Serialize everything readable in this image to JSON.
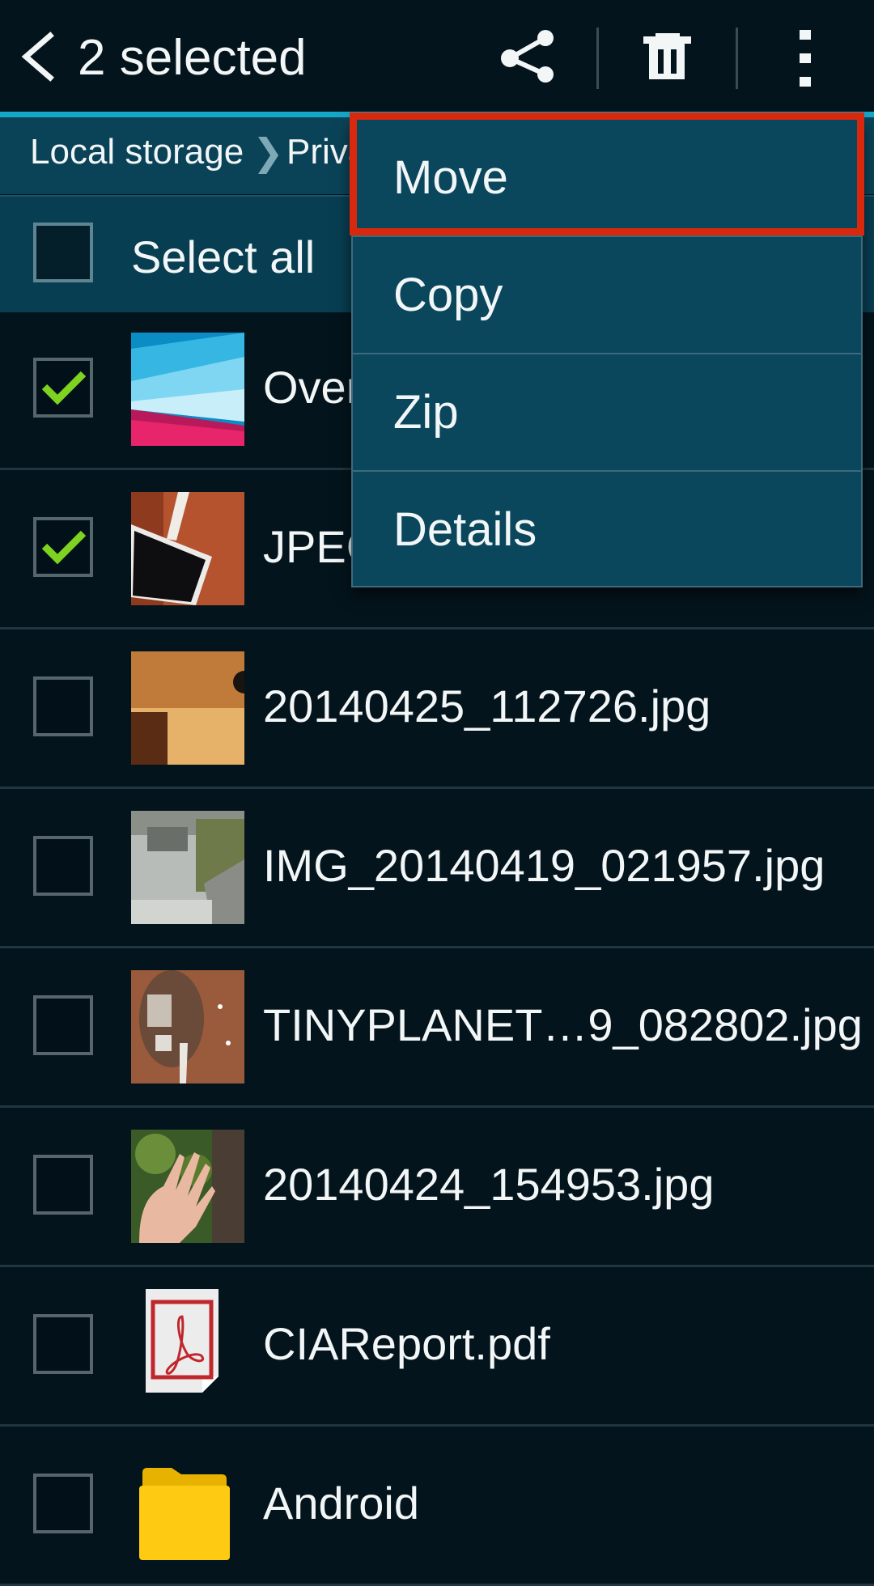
{
  "header": {
    "title": "2 selected",
    "back_icon": "chevron-left-icon",
    "actions": [
      {
        "name": "share",
        "icon": "share-icon"
      },
      {
        "name": "delete",
        "icon": "trash-icon"
      },
      {
        "name": "more",
        "icon": "more-vertical-icon"
      }
    ]
  },
  "breadcrumb": {
    "items": [
      "Local storage",
      "Priva"
    ],
    "separator": "❯"
  },
  "select_all": {
    "label": "Select all",
    "checked": false
  },
  "files": [
    {
      "name": "Over",
      "checked": true,
      "type": "image",
      "thumb": "abstract-wallpaper"
    },
    {
      "name": "JPEG",
      "checked": true,
      "type": "image",
      "thumb": "phone-on-table"
    },
    {
      "name": "20140425_112726.jpg",
      "checked": false,
      "type": "image",
      "thumb": "lamp-wall"
    },
    {
      "name": "IMG_20140419_021957.jpg",
      "checked": false,
      "type": "image",
      "thumb": "stone-steps"
    },
    {
      "name": "TINYPLANET…9_082802.jpg",
      "checked": false,
      "type": "image",
      "thumb": "tiny-planet"
    },
    {
      "name": "20140424_154953.jpg",
      "checked": false,
      "type": "image",
      "thumb": "hand-plants"
    },
    {
      "name": "CIAReport.pdf",
      "checked": false,
      "type": "pdf",
      "thumb": "pdf-icon"
    },
    {
      "name": "Android",
      "checked": false,
      "type": "folder",
      "thumb": "folder-icon"
    }
  ],
  "context_menu": {
    "items": [
      "Move",
      "Copy",
      "Zip",
      "Details"
    ],
    "highlighted": "Move"
  },
  "colors": {
    "accent": "#16a6c8",
    "check": "#7ed321",
    "highlight_box": "#d8290e",
    "menu_bg": "#0a475d",
    "background": "#04141c"
  }
}
